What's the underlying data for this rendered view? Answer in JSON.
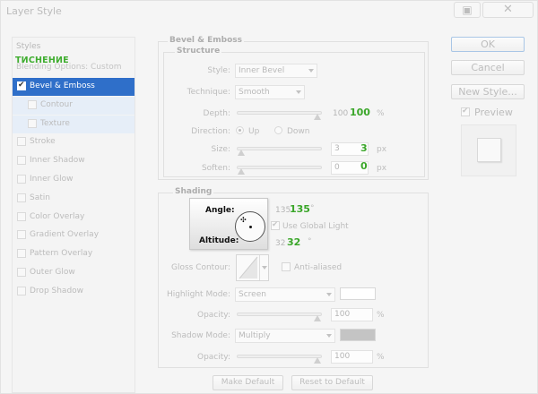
{
  "window": {
    "title": "Layer Style"
  },
  "titlebar": {
    "camera_glyph": "▣",
    "close_glyph": "✕"
  },
  "left_panel": {
    "styles_label": "Styles",
    "annotation": "ТИСНЕНИЕ",
    "blending_label": "Blending Options: Custom",
    "items": [
      {
        "label": "Bevel & Emboss",
        "checked": true,
        "selected": true
      },
      {
        "label": "Contour",
        "checked": false,
        "sub": true
      },
      {
        "label": "Texture",
        "checked": false,
        "sub": true
      },
      {
        "label": "Stroke",
        "checked": false
      },
      {
        "label": "Inner Shadow",
        "checked": false
      },
      {
        "label": "Inner Glow",
        "checked": false
      },
      {
        "label": "Satin",
        "checked": false
      },
      {
        "label": "Color Overlay",
        "checked": false
      },
      {
        "label": "Gradient Overlay",
        "checked": false
      },
      {
        "label": "Pattern Overlay",
        "checked": false
      },
      {
        "label": "Outer Glow",
        "checked": false
      },
      {
        "label": "Drop Shadow",
        "checked": false
      }
    ]
  },
  "bevel": {
    "section_title": "Bevel & Emboss",
    "structure_title": "Structure",
    "style_label": "Style:",
    "style_value": "Inner Bevel",
    "technique_label": "Technique:",
    "technique_value": "Smooth",
    "depth_label": "Depth:",
    "depth_value": "100",
    "depth_annot": "100",
    "depth_unit": "%",
    "depth_level": 1.0,
    "direction_label": "Direction:",
    "direction_up": "Up",
    "direction_down": "Down",
    "direction_selected": "Up",
    "size_label": "Size:",
    "size_value": "3",
    "size_annot": "3",
    "size_unit": "px",
    "size_level": 0.0,
    "soften_label": "Soften:",
    "soften_value": "0",
    "soften_annot": "0",
    "soften_unit": "px",
    "soften_level": 0.0
  },
  "shading": {
    "title": "Shading",
    "angle_label": "Angle:",
    "angle_value": "135",
    "angle_annot": "135",
    "degree": "°",
    "use_global_light": "Use Global Light",
    "use_global_light_checked": true,
    "altitude_label": "Altitude:",
    "altitude_value": "32",
    "altitude_annot": "32",
    "gloss_contour_label": "Gloss Contour:",
    "anti_aliased": "Anti-aliased",
    "anti_aliased_checked": false,
    "highlight_mode_label": "Highlight Mode:",
    "highlight_mode_value": "Screen",
    "highlight_color": "#ffffff",
    "highlight_opacity_label": "Opacity:",
    "highlight_opacity_value": "100",
    "highlight_opacity_level": 1.0,
    "shadow_mode_label": "Shadow Mode:",
    "shadow_mode_value": "Multiply",
    "shadow_color": "#c4c4c4",
    "shadow_opacity_label": "Opacity:",
    "shadow_opacity_value": "100",
    "shadow_opacity_level": 1.0,
    "percent": "%"
  },
  "footer": {
    "make_default": "Make Default",
    "reset_default": "Reset to Default"
  },
  "right_panel": {
    "ok": "OK",
    "cancel": "Cancel",
    "new_style": "New Style...",
    "preview_label": "Preview",
    "preview_checked": true
  },
  "colors": {
    "accent_selected": "#2f6fc9",
    "annotation_green": "#3aa629"
  }
}
